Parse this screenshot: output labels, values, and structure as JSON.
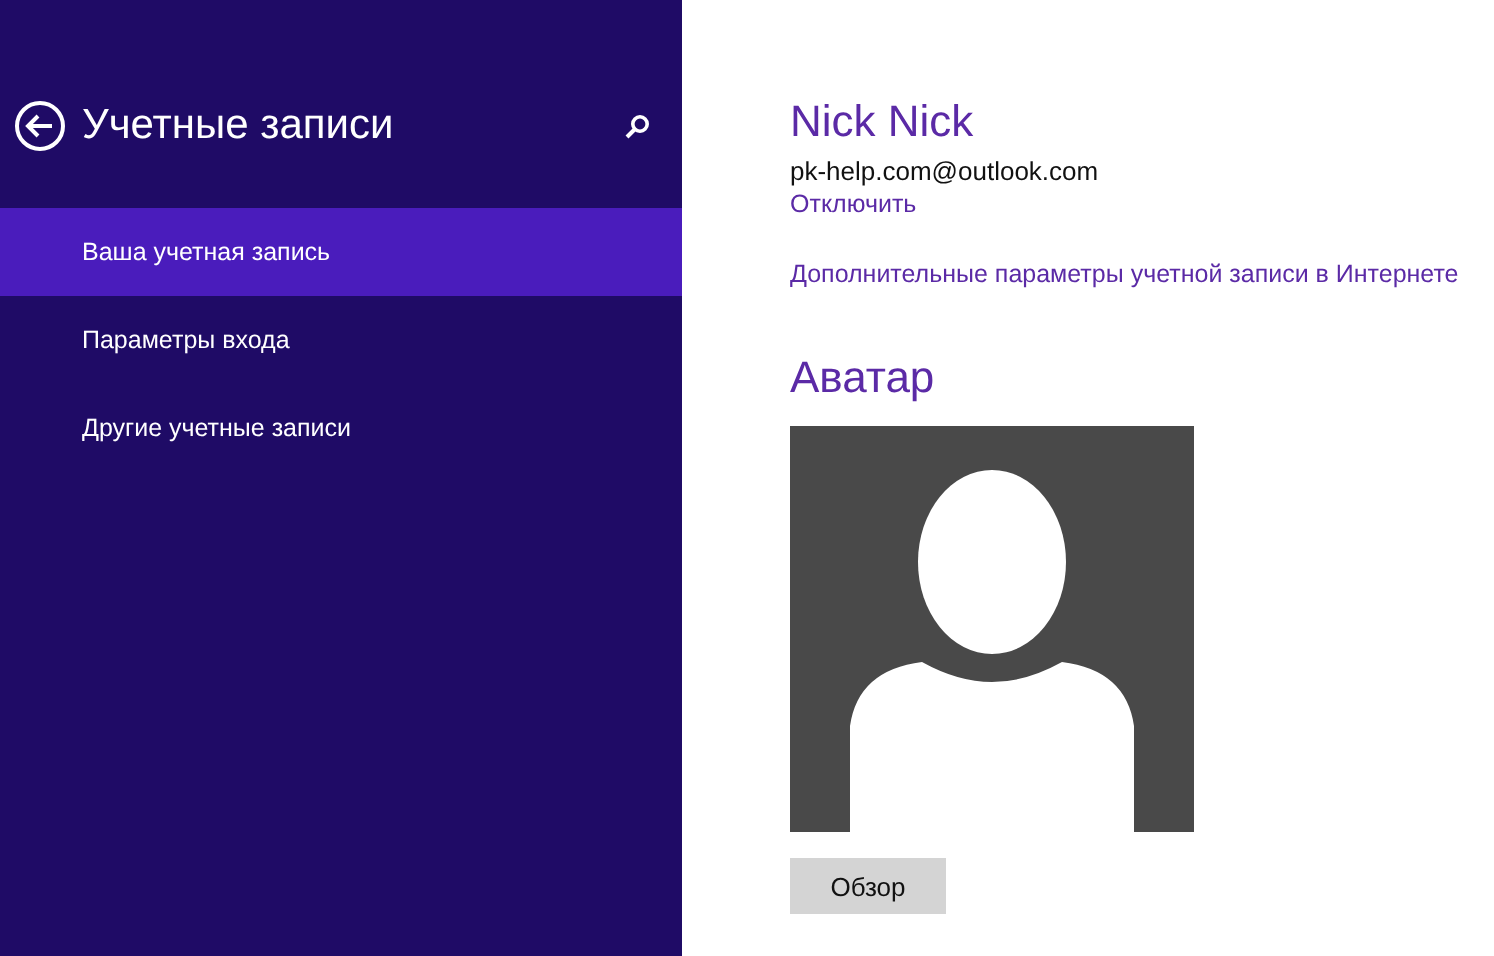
{
  "sidebar": {
    "title": "Учетные записи",
    "items": [
      {
        "label": "Ваша учетная запись",
        "selected": true
      },
      {
        "label": "Параметры входа",
        "selected": false
      },
      {
        "label": "Другие учетные записи",
        "selected": false
      }
    ]
  },
  "account": {
    "name": "Nick Nick",
    "email": "pk-help.com@outlook.com",
    "disconnect_link": "Отключить",
    "more_link": "Дополнительные параметры учетной записи в Интернете"
  },
  "avatar": {
    "heading": "Аватар",
    "browse_button": "Обзор"
  }
}
